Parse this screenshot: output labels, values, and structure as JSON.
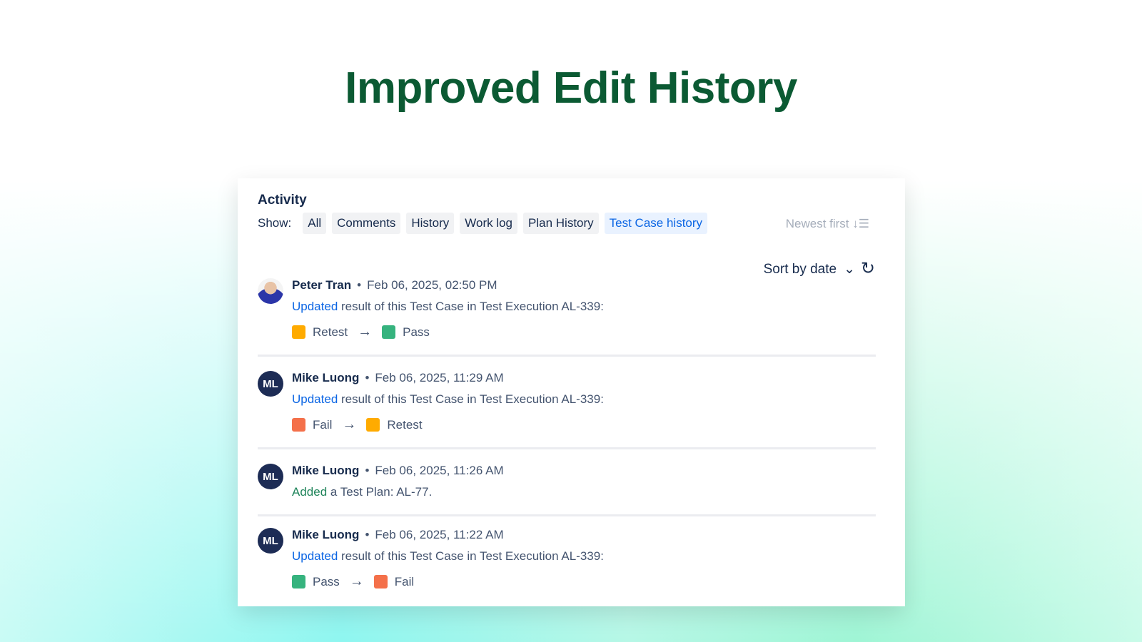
{
  "page_title": "Improved Edit History",
  "activity": {
    "heading": "Activity",
    "show_label": "Show:",
    "filters": [
      {
        "label": "All"
      },
      {
        "label": "Comments"
      },
      {
        "label": "History"
      },
      {
        "label": "Work log"
      },
      {
        "label": "Plan History"
      },
      {
        "label": "Test Case history",
        "active": true
      }
    ],
    "order_label": "Newest first ↓☰",
    "sort_label": "Sort by date",
    "sort_chevron": "⌄",
    "refresh_icon": "↻",
    "arrow": "→",
    "status_colors": {
      "Retest": "#ffab00",
      "Pass": "#36b37e",
      "Fail": "#f4704a"
    },
    "entries": [
      {
        "author": "Peter Tran",
        "initials": "",
        "date": "Feb 06, 2025, 02:50 PM",
        "verb": "Updated",
        "text": " result of this Test Case in Test Execution AL-339:",
        "from": "Retest",
        "to": "Pass"
      },
      {
        "author": "Mike Luong",
        "initials": "ML",
        "date": "Feb 06, 2025, 11:29 AM",
        "verb": "Updated",
        "text": " result of this Test Case in Test Execution AL-339:",
        "from": "Fail",
        "to": "Retest"
      },
      {
        "author": "Mike Luong",
        "initials": "ML",
        "date": "Feb 06, 2025, 11:26 AM",
        "verb": "Added",
        "text": " a Test Plan: AL-77."
      },
      {
        "author": "Mike Luong",
        "initials": "ML",
        "date": "Feb 06, 2025, 11:22 AM",
        "verb": "Updated",
        "text": " result of this Test Case in Test Execution AL-339:",
        "from": "Pass",
        "to": "Fail"
      }
    ]
  }
}
